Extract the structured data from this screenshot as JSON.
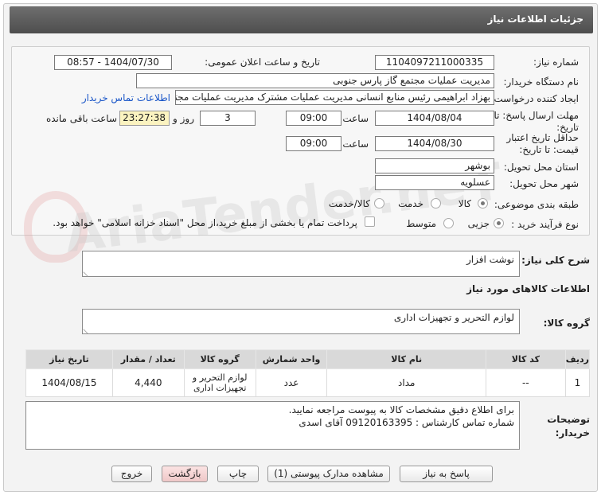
{
  "window": {
    "title": "جزئیات اطلاعات نیاز"
  },
  "watermark": {
    "text": "AriaTender.neT"
  },
  "form": {
    "need_number": {
      "label": "شماره نیاز:",
      "value": "1104097211000335"
    },
    "announce": {
      "label": "تاریخ و ساعت اعلان عمومی:",
      "value": "1404/07/30 - 08:57"
    },
    "buyer_org": {
      "label": "نام دستگاه خریدار:",
      "value": "مدیریت عملیات مجتمع گاز پارس جنوبی"
    },
    "creator": {
      "label": "ایجاد کننده درخواست:",
      "value": "بهزاد ابراهیمی رئیس منابع انسانی مدیریت عملیات مشترک  مدیریت عملیات مجتمع",
      "contact_link": "اطلاعات تماس خریدار"
    },
    "deadline": {
      "label1": "مهلت ارسال پاسخ: تا",
      "label2": "تاریخ:",
      "date": "1404/08/04",
      "time_label": "ساعت",
      "time": "09:00",
      "days": "3",
      "days_label": "روز و",
      "countdown": "23:27:38",
      "remaining_label": "ساعت باقی مانده"
    },
    "validity": {
      "label1": "حداقل تاریخ اعتبار",
      "label2": "قیمت: تا تاریخ:",
      "date": "1404/08/30",
      "time_label": "ساعت",
      "time": "09:00"
    },
    "province": {
      "label": "استان محل تحویل:",
      "value": "بوشهر"
    },
    "city": {
      "label": "شهر محل تحویل:",
      "value": "عسلویه"
    },
    "category": {
      "label": "طبقه بندی موضوعی:",
      "options": [
        "کالا",
        "خدمت",
        "کالا/خدمت"
      ],
      "selected": "کالا"
    },
    "purchase_type": {
      "label": "نوع فرآیند خرید :",
      "options": [
        "جزیی",
        "متوسط"
      ],
      "selected": "جزیی",
      "note": "پرداخت تمام یا بخشی از مبلغ خرید،از محل \"اسناد خزانه اسلامی\" خواهد بود."
    }
  },
  "description": {
    "label": "شرح کلی نیاز:",
    "value": "نوشت افزار"
  },
  "goods_info": {
    "heading": "اطلاعات کالاهای مورد نیاز"
  },
  "goods_group": {
    "label": "گروه کالا:",
    "value": "لوازم التحریر و تجهیزات اداری"
  },
  "table": {
    "headers": [
      "ردیف",
      "کد کالا",
      "نام کالا",
      "واحد شمارش",
      "گروه کالا",
      "تعداد / مقدار",
      "تاریخ نیاز"
    ],
    "rows": [
      [
        "1",
        "--",
        "مداد",
        "عدد",
        "لوازم التحریر و تجهیزات اداری",
        "4,440",
        "1404/08/15"
      ]
    ]
  },
  "buyer_notes": {
    "label1": "توضیحات",
    "label2": "خریدار:",
    "line1": "برای اطلاع دقیق مشخصات کالا به پیوست مراجعه نمایید.",
    "line2": "شماره تماس کارشناس : 09120163395 آقای اسدی"
  },
  "buttons": {
    "reply": "پاسخ به نیاز",
    "attachments": "مشاهده مدارک پیوستی (1)",
    "print": "چاپ",
    "back": "بازگشت",
    "exit": "خروج"
  }
}
